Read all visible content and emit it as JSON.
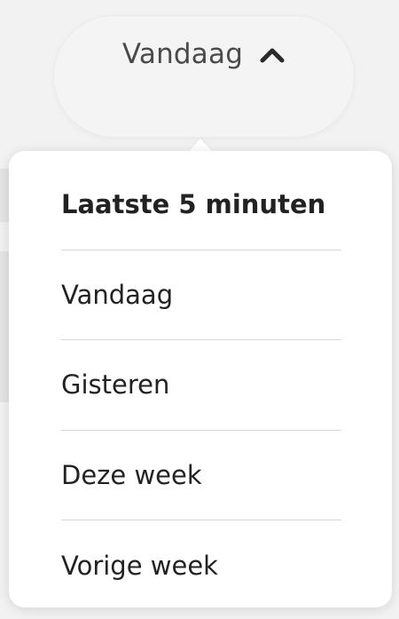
{
  "toggle": {
    "label": "Vandaag",
    "icon": "chevron-up-icon"
  },
  "menu": {
    "items": [
      {
        "label": "Laatste 5 minuten"
      },
      {
        "label": "Vandaag"
      },
      {
        "label": "Gisteren"
      },
      {
        "label": "Deze week"
      },
      {
        "label": "Vorige week"
      }
    ]
  },
  "colors": {
    "background": "#f2f2f2",
    "panel": "#ffffff",
    "text": "#222222",
    "divider": "#d6d6d6"
  }
}
